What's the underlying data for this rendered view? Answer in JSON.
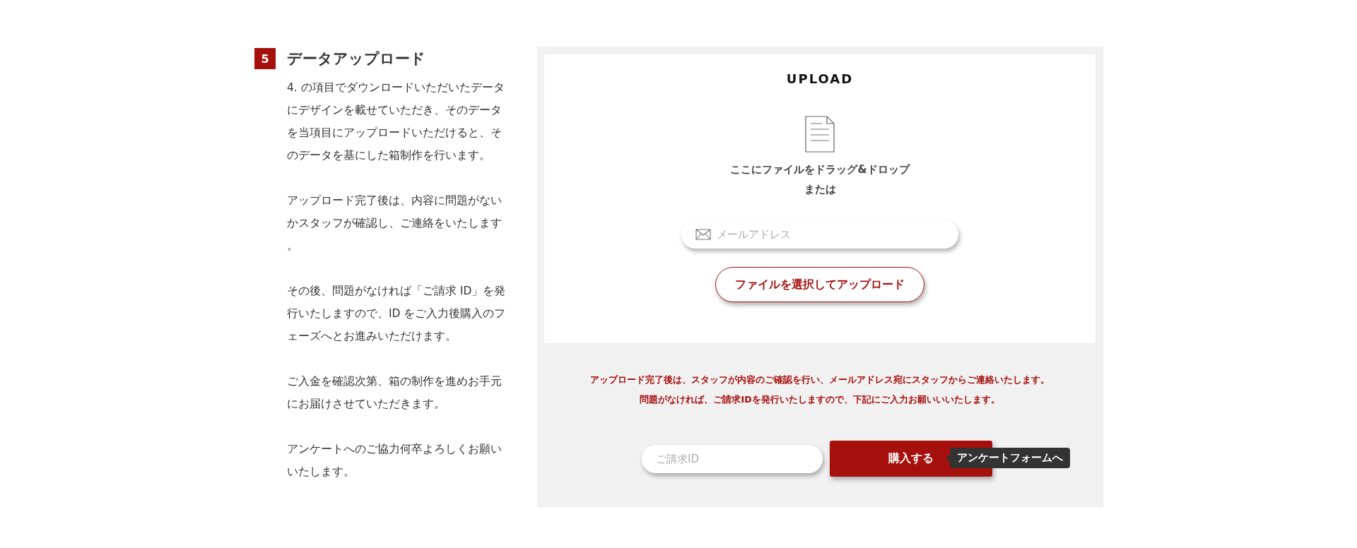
{
  "section": {
    "number": "5",
    "title": "データアップロード",
    "paragraphs": [
      "4. の項目でダウンロードいただいたデータにデザインを載せていただき、そのデータを当項目にアップロードいただけると、そのデータを基にした箱制作を行います。",
      "アップロード完了後は、内容に問題がないかスタッフが確認し、ご連絡をいたします。",
      "その後、問題がなければ「ご請求 ID」を発行いたしますので、ID をご入力後購入のフェーズへとお進みいただけます。",
      "ご入金を確認次第、箱の制作を進めお手元にお届けさせていただきます。",
      "アンケートへのご協力何卒よろしくお願いいたします。"
    ]
  },
  "upload": {
    "title": "UPLOAD",
    "drop_text": "ここにファイルをドラッグ&ドロップ",
    "or_text": "または",
    "email_field": {
      "placeholder": "メールアドレス"
    },
    "upload_button": "ファイルを選択してアップロード"
  },
  "notice": [
    "アップロード完了後は、スタッフが内容のご確認を行い、メールアドレス宛にスタッフからご連絡いたします。",
    "問題がなければ、ご請求IDを発行いたしますので、下記にご入力お願いいいたします。"
  ],
  "purchase": {
    "id_field": {
      "placeholder": "ご請求ID"
    },
    "buy_button": "購入する",
    "tooltip": "アンケートフォームへ"
  }
}
